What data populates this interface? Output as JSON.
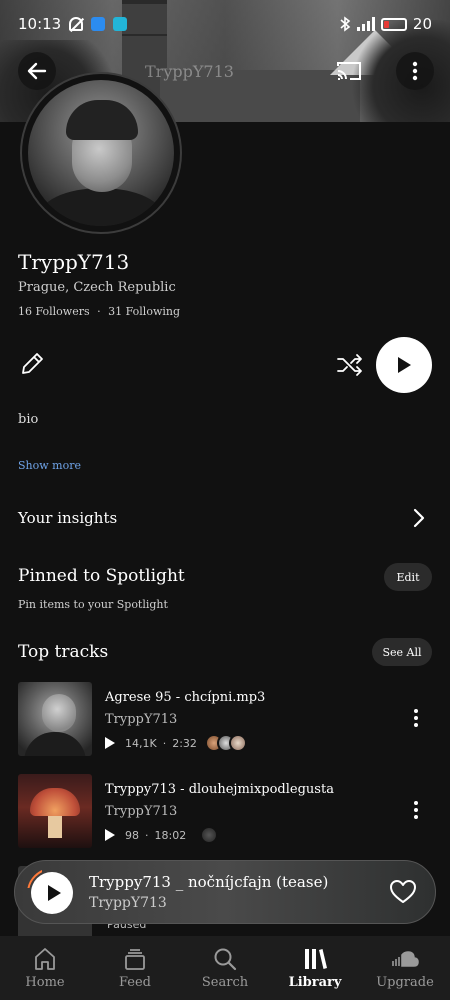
{
  "status_bar": {
    "time": "10:13",
    "battery": "20"
  },
  "header": {
    "banner_name": "TryppY713"
  },
  "profile": {
    "name": "TryppY713",
    "location": "Prague, Czech Republic",
    "followers": "16 Followers",
    "following": "31 Following",
    "separator": "·",
    "bio": "bio",
    "show_more": "Show more"
  },
  "insights": {
    "label": "Your insights"
  },
  "spotlight": {
    "title": "Pinned to Spotlight",
    "hint": "Pin items to your Spotlight",
    "edit_label": "Edit"
  },
  "top_tracks": {
    "title": "Top tracks",
    "see_all": "See All",
    "items": [
      {
        "title": "Agrese 95 - chcípni.mp3",
        "artist": "TryppY713",
        "plays": "14,1K",
        "duration": "2:32"
      },
      {
        "title": "Tryppy713 - dlouhejmixpodlegusta",
        "artist": "TryppY713",
        "plays": "98",
        "duration": "18:02"
      }
    ],
    "third_status": "Paused"
  },
  "player": {
    "title": "Tryppy713 _ nočníjcfajn (tease)",
    "artist": "TryppY713"
  },
  "nav": {
    "items": [
      {
        "label": "Home"
      },
      {
        "label": "Feed"
      },
      {
        "label": "Search"
      },
      {
        "label": "Library"
      },
      {
        "label": "Upgrade"
      }
    ],
    "active": "Library"
  },
  "colors": {
    "background": "#111111",
    "link": "#6fa3e8",
    "progress": "#ff7a3a",
    "nav_bg": "#1d1d1d"
  },
  "icons": [
    "back-arrow-icon",
    "cast-icon",
    "more-vertical-icon",
    "pencil-icon",
    "shuffle-icon",
    "play-icon",
    "chevron-right-icon",
    "heart-icon",
    "home-icon",
    "feed-icon",
    "search-icon",
    "library-icon",
    "soundcloud-icon"
  ]
}
